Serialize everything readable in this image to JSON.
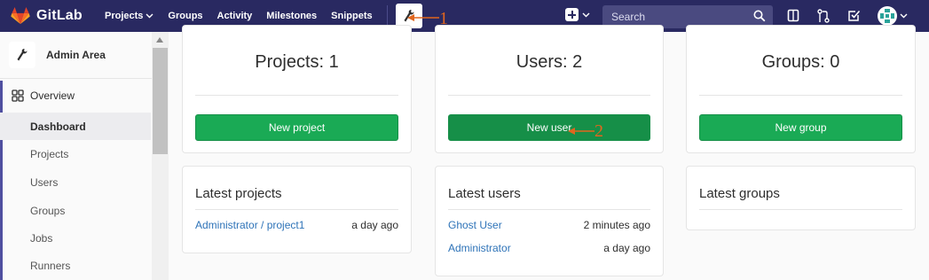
{
  "navbar": {
    "brand": "GitLab",
    "links": [
      "Projects",
      "Groups",
      "Activity",
      "Milestones",
      "Snippets"
    ],
    "search_placeholder": "Search"
  },
  "annotations": [
    "1",
    "2"
  ],
  "sidebar": {
    "title": "Admin Area",
    "section": "Overview",
    "items": [
      "Dashboard",
      "Projects",
      "Users",
      "Groups",
      "Jobs",
      "Runners"
    ],
    "active": "Dashboard"
  },
  "stats": [
    {
      "title": "Projects: 1",
      "button": "New project"
    },
    {
      "title": "Users: 2",
      "button": "New user"
    },
    {
      "title": "Groups: 0",
      "button": "New group"
    }
  ],
  "latest_projects": {
    "title": "Latest projects",
    "rows": [
      {
        "name": "Administrator / project1",
        "time": "a day ago"
      }
    ]
  },
  "latest_users": {
    "title": "Latest users",
    "rows": [
      {
        "name": "Ghost User",
        "time": "2 minutes ago"
      },
      {
        "name": "Administrator",
        "time": "a day ago"
      }
    ]
  },
  "latest_groups": {
    "title": "Latest groups"
  },
  "colors": {
    "navbar": "#292961",
    "button_green": "#1aaa55",
    "link_blue": "#2e73b8",
    "annotation_orange": "#e0661e"
  }
}
